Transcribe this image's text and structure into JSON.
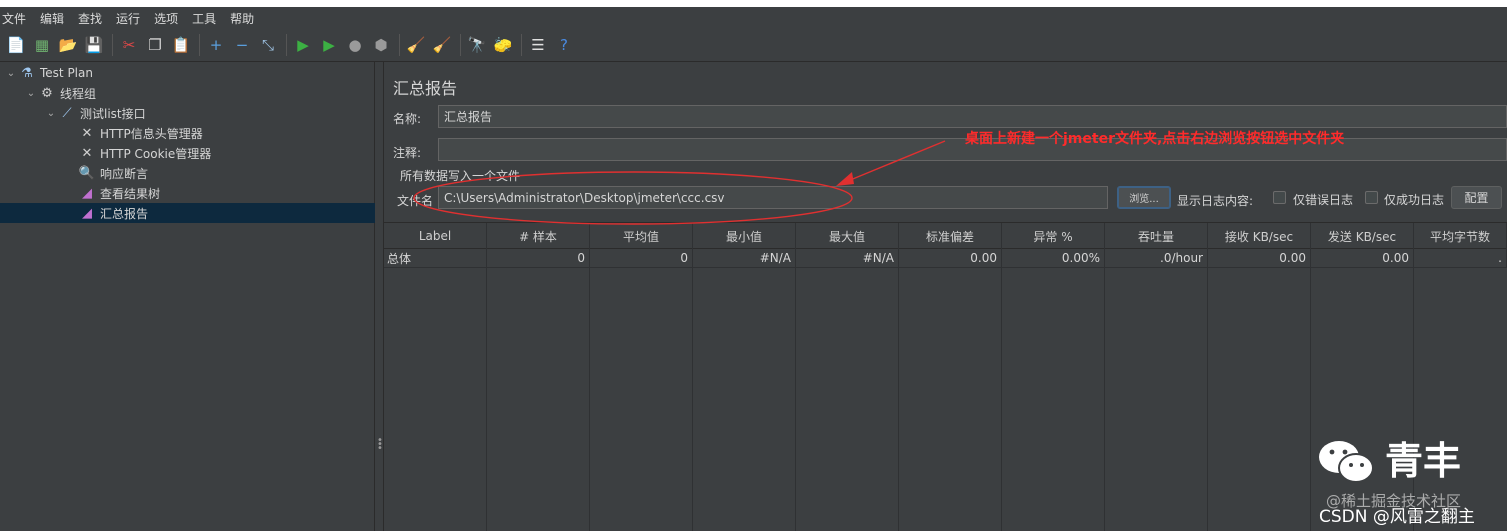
{
  "menu": [
    "文件",
    "编辑",
    "查找",
    "运行",
    "选项",
    "工具",
    "帮助"
  ],
  "toolbar": {
    "icons": [
      {
        "name": "new-icon",
        "glyph": "📄",
        "color": "#e8e8e8"
      },
      {
        "name": "templates-icon",
        "glyph": "▦",
        "color": "#6fb26f"
      },
      {
        "name": "open-icon",
        "glyph": "📂",
        "color": "#e0b040"
      },
      {
        "name": "save-icon",
        "glyph": "💾",
        "color": "#cfcfcf"
      },
      {
        "name": "cut-icon",
        "glyph": "✂",
        "color": "#e04848"
      },
      {
        "name": "copy-icon",
        "glyph": "❐",
        "color": "#d0d0d0"
      },
      {
        "name": "paste-icon",
        "glyph": "📋",
        "color": "#e0c070"
      },
      {
        "name": "expand-icon",
        "glyph": "+",
        "color": "#5aa0e0"
      },
      {
        "name": "collapse-icon",
        "glyph": "−",
        "color": "#5aa0e0"
      },
      {
        "name": "toggle-icon",
        "glyph": "⤡",
        "color": "#9cc0e0"
      },
      {
        "name": "start-icon",
        "glyph": "▶",
        "color": "#3cb043"
      },
      {
        "name": "start-no-pauses-icon",
        "glyph": "▶",
        "color": "#3cb043"
      },
      {
        "name": "stop-icon",
        "glyph": "●",
        "color": "#9a9a9a"
      },
      {
        "name": "shutdown-icon",
        "glyph": "⬢",
        "color": "#9a9a9a"
      },
      {
        "name": "clear-icon",
        "glyph": "🧹",
        "color": "#d0b070"
      },
      {
        "name": "clear-all-icon",
        "glyph": "🧹",
        "color": "#d0b070"
      },
      {
        "name": "search-icon",
        "glyph": "🔭",
        "color": "#cfcfcf"
      },
      {
        "name": "reset-search-icon",
        "glyph": "🧽",
        "color": "#e6c040"
      },
      {
        "name": "function-helper-icon",
        "glyph": "☰",
        "color": "#e0e0e0"
      },
      {
        "name": "help-icon",
        "glyph": "?",
        "color": "#4a8ae0"
      }
    ]
  },
  "tree": [
    {
      "label": "Test Plan",
      "icon": "flask-icon",
      "glyph": "⚗",
      "indent": 0,
      "chevron": "⌄"
    },
    {
      "label": "线程组",
      "icon": "gear-icon",
      "glyph": "⚙",
      "indent": 1,
      "chevron": "⌄"
    },
    {
      "label": "测试list接口",
      "icon": "pipette-icon",
      "glyph": "⟋",
      "indent": 2,
      "chevron": "⌄"
    },
    {
      "label": "HTTP信息头管理器",
      "icon": "wrench-icon",
      "glyph": "✕",
      "indent": 3,
      "chevron": ""
    },
    {
      "label": "HTTP Cookie管理器",
      "icon": "wrench-icon",
      "glyph": "✕",
      "indent": 3,
      "chevron": ""
    },
    {
      "label": "响应断言",
      "icon": "magnifier-icon",
      "glyph": "🔍",
      "indent": 3,
      "chevron": ""
    },
    {
      "label": "查看结果树",
      "icon": "chart-icon",
      "glyph": "◢",
      "indent": 3,
      "chevron": ""
    },
    {
      "label": "汇总报告",
      "icon": "chart-icon",
      "glyph": "◢",
      "indent": 3,
      "chevron": ""
    }
  ],
  "panel": {
    "title": "汇总报告",
    "name_label": "名称:",
    "name_value": "汇总报告",
    "comment_label": "注释:",
    "comment_value": "",
    "write_all_label": "所有数据写入一个文件",
    "filename_label": "文件名",
    "filename_value": "C:\\Users\\Administrator\\Desktop\\jmeter\\ccc.csv",
    "browse_label": "浏览...",
    "log_display_label": "显示日志内容:",
    "errors_only_label": "仅错误日志",
    "errors_only_checked": false,
    "success_only_label": "仅成功日志",
    "success_only_checked": false,
    "configure_label": "配置"
  },
  "table": {
    "headers": [
      "Label",
      "# 样本",
      "平均值",
      "最小值",
      "最大值",
      "标准偏差",
      "异常 %",
      "吞吐量",
      "接收 KB/sec",
      "发送 KB/sec",
      "平均字节数"
    ],
    "rows": [
      [
        "总体",
        "0",
        "0",
        "#N/A",
        "#N/A",
        "0.00",
        "0.00%",
        ".0/hour",
        "0.00",
        "0.00",
        "."
      ]
    ]
  },
  "annotation": {
    "text": "桌面上新建一个jmeter文件夹,点击右边浏览按钮选中文件夹",
    "color": "#ff2b2b"
  },
  "watermark": {
    "brand": "青丰",
    "juejin": "@稀土掘金技术社区",
    "csdn": "CSDN @风雷之翻主"
  }
}
